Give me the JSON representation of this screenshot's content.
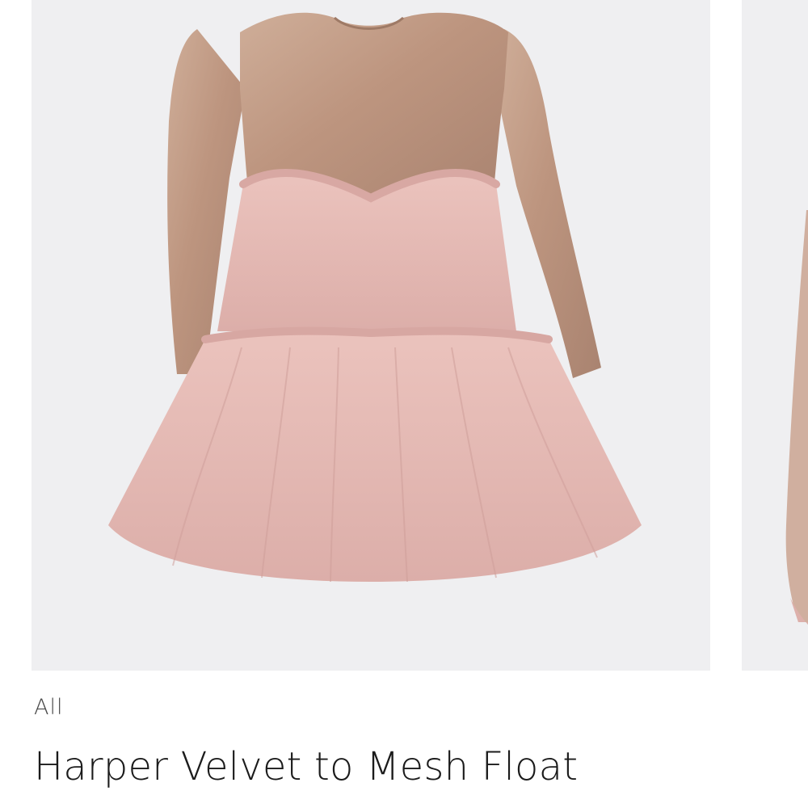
{
  "product": {
    "category": "All",
    "name": "Harper Velvet to Mesh Float",
    "image_description_icon": "dress-product-photo"
  },
  "colors": {
    "image_background": "#efeff1",
    "velvet": "#c09a86",
    "mesh": "#e2b7b2",
    "text": "#1b1b1b"
  }
}
